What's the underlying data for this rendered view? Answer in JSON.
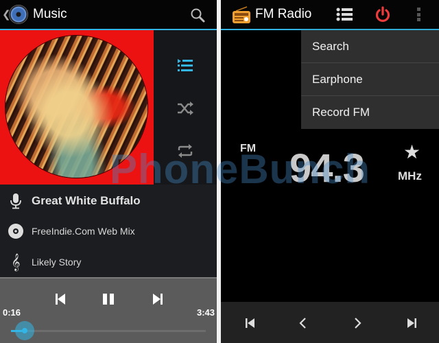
{
  "music": {
    "app_title": "Music",
    "icons": {
      "back": "chevron-left-icon",
      "app": "speaker-disc-icon",
      "search": "search-icon",
      "queue": "queue-list-icon",
      "shuffle": "shuffle-icon",
      "repeat": "repeat-icon"
    },
    "track": {
      "title": "Great White Buffalo",
      "album": "FreeIndie.Com Web Mix",
      "artist": "Likely Story"
    },
    "playback": {
      "elapsed": "0:16",
      "duration": "3:43",
      "progress_fraction": 0.072,
      "state": "playing"
    },
    "colors": {
      "accent": "#33b5e5",
      "album_bg": "#ec1212"
    }
  },
  "radio": {
    "app_title": "FM Radio",
    "menu": [
      {
        "label": "Search"
      },
      {
        "label": "Earphone"
      },
      {
        "label": "Record FM"
      }
    ],
    "band": "FM",
    "frequency": "94.3",
    "unit": "MHz",
    "favorite_icon": "star-icon",
    "colors": {
      "power": "#ee3b3b",
      "radio_icon": "#f0a030"
    }
  },
  "watermark": "PhoneBunch"
}
